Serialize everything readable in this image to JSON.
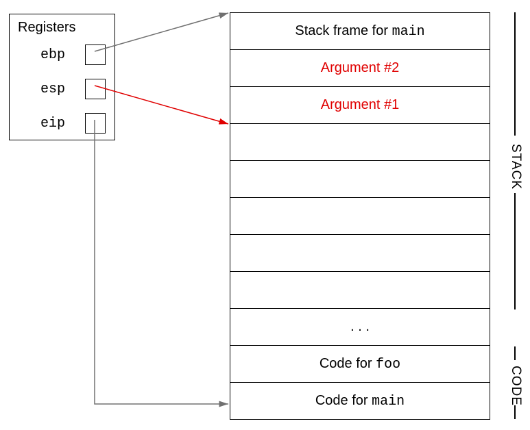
{
  "registers": {
    "title": "Registers",
    "items": [
      {
        "name": "ebp"
      },
      {
        "name": "esp"
      },
      {
        "name": "eip"
      }
    ]
  },
  "memory": {
    "rows": [
      {
        "text": "Stack frame for ",
        "mono": "main",
        "color": "black"
      },
      {
        "text": "Argument #2",
        "mono": "",
        "color": "red"
      },
      {
        "text": "Argument #1",
        "mono": "",
        "color": "red"
      },
      {
        "text": "",
        "mono": "",
        "color": "black"
      },
      {
        "text": "",
        "mono": "",
        "color": "black"
      },
      {
        "text": "",
        "mono": "",
        "color": "black"
      },
      {
        "text": "",
        "mono": "",
        "color": "black"
      },
      {
        "text": "",
        "mono": "",
        "color": "black"
      },
      {
        "text": ". . .",
        "mono": "",
        "color": "black"
      },
      {
        "text": "Code for ",
        "mono": "foo",
        "color": "black"
      },
      {
        "text": "Code for ",
        "mono": "main",
        "color": "black"
      }
    ]
  },
  "side_labels": {
    "stack": "STACK",
    "code": "CODE"
  },
  "arrows": [
    {
      "from": "ebp",
      "to_row": 0,
      "color": "gray"
    },
    {
      "from": "esp",
      "to_row": 3,
      "color": "red"
    },
    {
      "from": "eip",
      "to_row": 10,
      "color": "gray"
    }
  ],
  "chart_data": {
    "type": "table",
    "title": "Register-to-memory diagram",
    "registers": [
      "ebp",
      "esp",
      "eip"
    ],
    "memory_rows": [
      "Stack frame for main",
      "Argument #2",
      "Argument #1",
      "",
      "",
      "",
      "",
      "",
      ". . .",
      "Code for foo",
      "Code for main"
    ],
    "pointers": [
      {
        "register": "ebp",
        "points_to_row_index": 0
      },
      {
        "register": "esp",
        "points_to_row_index": 3
      },
      {
        "register": "eip",
        "points_to_row_index": 10
      }
    ],
    "regions": [
      {
        "label": "STACK",
        "row_start": 0,
        "row_end": 7
      },
      {
        "label": "CODE",
        "row_start": 9,
        "row_end": 10
      }
    ]
  }
}
